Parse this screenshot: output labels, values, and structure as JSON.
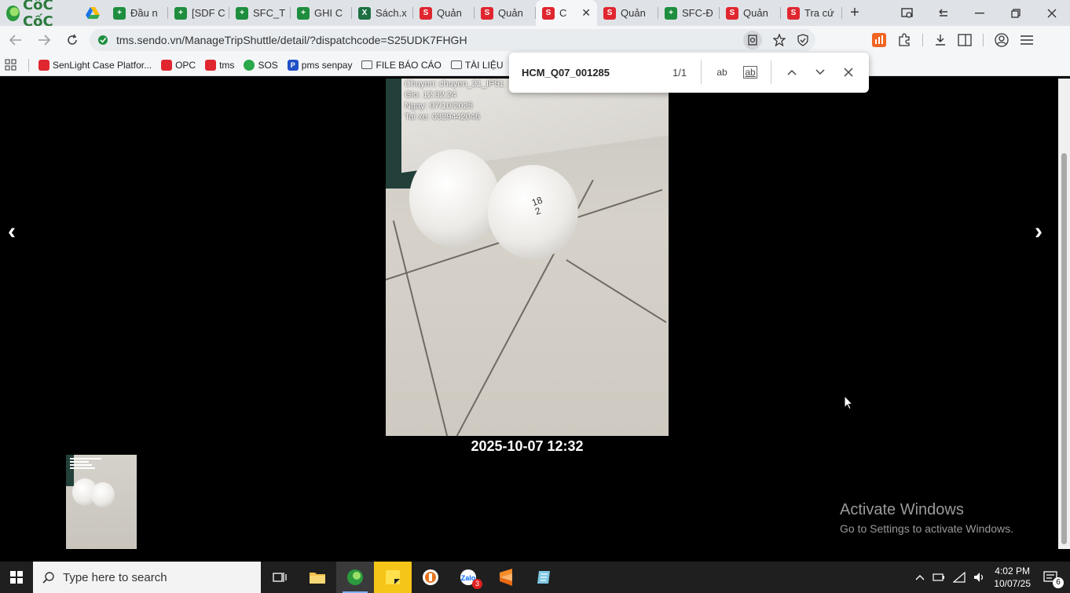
{
  "browser": {
    "brand": "CốC CốC",
    "tabs": [
      {
        "label": "Đầu n",
        "icon": "sheets-icon"
      },
      {
        "label": "[SDF C",
        "icon": "sheets-icon"
      },
      {
        "label": "SFC_T",
        "icon": "sheets-icon"
      },
      {
        "label": "GHI C",
        "icon": "sheets-icon"
      },
      {
        "label": "Sách.x",
        "icon": "excel-icon"
      },
      {
        "label": "Quản",
        "icon": "sendo-icon"
      },
      {
        "label": "Quản",
        "icon": "sendo-icon"
      },
      {
        "label": "C",
        "icon": "sendo-icon",
        "active": true
      },
      {
        "label": "Quản",
        "icon": "sendo-icon"
      },
      {
        "label": "SFC-Đ",
        "icon": "sheets-icon"
      },
      {
        "label": "Quản",
        "icon": "sendo-icon"
      },
      {
        "label": "Tra cứ",
        "icon": "sendo-icon"
      }
    ],
    "url": "tms.sendo.vn/ManageTripShuttle/detail/?dispatchcode=S25UDK7FHGH",
    "bookmarks": [
      {
        "label": "SenLight Case Platfor...",
        "icon": "sendo-icon"
      },
      {
        "label": "OPC",
        "icon": "sendo-icon"
      },
      {
        "label": "tms",
        "icon": "sendo-icon"
      },
      {
        "label": "SOS",
        "icon": "sos-icon"
      },
      {
        "label": "pms senpay",
        "icon": "pms-icon"
      },
      {
        "label": "FILE BÁO CÁO",
        "icon": "folder-icon"
      },
      {
        "label": "TÀI LIỆU",
        "icon": "folder-icon"
      }
    ]
  },
  "findbar": {
    "query": "HCM_Q07_001285",
    "count": "1/1",
    "match_case": "ab",
    "whole_word": "ab"
  },
  "viewer": {
    "overlay": {
      "line1": "Chuyen: chuyen_21_IP51",
      "line2": "Gio: 12:32:24",
      "line3": "Ngay: 07/10/2025",
      "line4": "Tai xe: 0329442046"
    },
    "bag_label": "18\n2",
    "timestamp": "2025-10-07 12:32",
    "prev": "‹",
    "next": "›"
  },
  "watermark": {
    "title": "Activate Windows",
    "subtitle": "Go to Settings to activate Windows."
  },
  "taskbar": {
    "search_placeholder": "Type here to search",
    "time": "4:02 PM",
    "date": "10/07/25",
    "zalo_badge": "3",
    "notification_count": "6"
  }
}
